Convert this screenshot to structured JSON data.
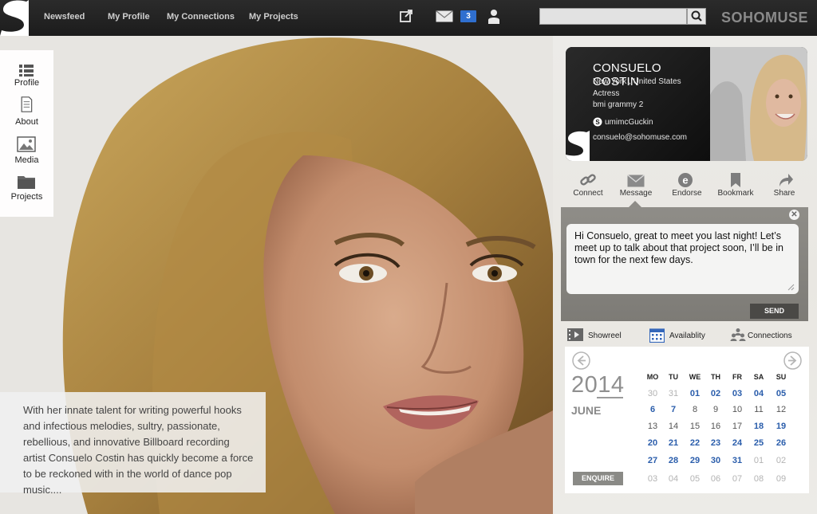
{
  "header": {
    "nav": [
      "Newsfeed",
      "My Profile",
      "My Connections",
      "My Projects"
    ],
    "message_count": "3",
    "search_placeholder": "",
    "brand": "SOHOMUSE",
    "icons": [
      "external-link-icon",
      "mail-icon",
      "user-icon",
      "search-icon"
    ]
  },
  "sidenav": {
    "items": [
      {
        "label": "Profile",
        "icon": "list-icon"
      },
      {
        "label": "About",
        "icon": "document-icon"
      },
      {
        "label": "Media",
        "icon": "image-icon"
      },
      {
        "label": "Projects",
        "icon": "folder-icon"
      }
    ]
  },
  "bio": "With her innate talent for writing powerful hooks and infectious melodies, sultry, passionate, rebellious, and innovative Billboard recording artist Consuelo Costin has quickly become a force to be reckoned with in the world of dance pop music....",
  "profile": {
    "name": "CONSUELO COSTIN",
    "location": "New York , United States",
    "role": "Actress",
    "award": "bmi grammy 2",
    "skype": "umimcGuckin",
    "email": "consuelo@sohomuse.com"
  },
  "actions": [
    "Connect",
    "Message",
    "Endorse",
    "Bookmark",
    "Share"
  ],
  "message": {
    "text": "Hi Consuelo, great to meet you last night! Let’s meet up to talk about that project soon, I’ll be in town for the next few days.",
    "send_label": "SEND"
  },
  "tabs": [
    "Showreel",
    "Availablity",
    "Connections"
  ],
  "calendar": {
    "year": "2014",
    "month": "JUNE",
    "enquire_label": "ENQUIRE",
    "weekdays": [
      "MO",
      "TU",
      "WE",
      "TH",
      "FR",
      "SA",
      "SU"
    ],
    "weeks": [
      [
        [
          "30",
          "other"
        ],
        [
          "31",
          "other"
        ],
        [
          "01",
          "avail"
        ],
        [
          "02",
          "avail"
        ],
        [
          "03",
          "avail"
        ],
        [
          "04",
          "avail"
        ],
        [
          "05",
          "avail"
        ]
      ],
      [
        [
          "6",
          "avail"
        ],
        [
          "7",
          "avail"
        ],
        [
          "8",
          "norm"
        ],
        [
          "9",
          "norm"
        ],
        [
          "10",
          "norm"
        ],
        [
          "11",
          "norm"
        ],
        [
          "12",
          "norm"
        ]
      ],
      [
        [
          "13",
          "norm"
        ],
        [
          "14",
          "norm"
        ],
        [
          "15",
          "norm"
        ],
        [
          "16",
          "norm"
        ],
        [
          "17",
          "norm"
        ],
        [
          "18",
          "avail"
        ],
        [
          "19",
          "avail"
        ]
      ],
      [
        [
          "20",
          "avail"
        ],
        [
          "21",
          "avail"
        ],
        [
          "22",
          "avail"
        ],
        [
          "23",
          "avail"
        ],
        [
          "24",
          "avail"
        ],
        [
          "25",
          "avail"
        ],
        [
          "26",
          "avail"
        ]
      ],
      [
        [
          "27",
          "avail"
        ],
        [
          "28",
          "avail"
        ],
        [
          "29",
          "avail"
        ],
        [
          "30",
          "avail"
        ],
        [
          "31",
          "avail"
        ],
        [
          "01",
          "other"
        ],
        [
          "02",
          "other"
        ]
      ],
      [
        [
          "03",
          "other"
        ],
        [
          "04",
          "other"
        ],
        [
          "05",
          "other"
        ],
        [
          "06",
          "other"
        ],
        [
          "07",
          "other"
        ],
        [
          "08",
          "other"
        ],
        [
          "09",
          "other"
        ]
      ]
    ]
  },
  "colors": {
    "topbar": "#1f1f1f",
    "available_day": "#2a5dab",
    "badge": "#2f6fcf"
  }
}
